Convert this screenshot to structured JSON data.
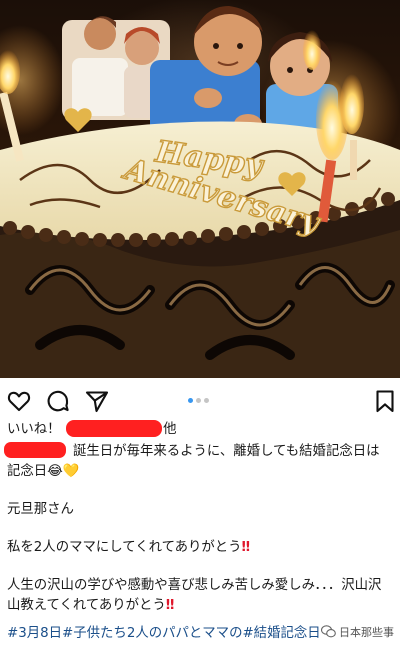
{
  "post": {
    "photo_subject": "",
    "likes_prefix": "いいね！",
    "likes_suffix": "他",
    "caption_line1": "誕生日が毎年来るように、離婚しても結婚記念日は",
    "caption_line2": "記念日",
    "caption_line2_emoji": "😂💛",
    "caption_line3": "元旦那さん",
    "caption_line4": "私を2人のママにしてくれてありがとう",
    "caption_line4_bangs": "‼",
    "caption_line5": "人生の沢山の学びや感動や喜び悲しみ苦しみ愛しみ．．．沢山沢",
    "caption_line6": "山教えてくれてありがとう",
    "caption_line6_bangs": "‼",
    "hashtags": "#3月8日#子供たち2人のパパとママの#結婚記念日"
  },
  "cake_text": {
    "line1": "Happy",
    "line2": "Anniversary"
  },
  "watermark": {
    "text": "日本那些事"
  },
  "icons": {
    "like": "heart-outline-icon",
    "comment": "comment-bubble-icon",
    "share": "paper-plane-icon",
    "save": "bookmark-icon"
  },
  "colors": {
    "accent_blue": "#3897f0",
    "hashtag": "#1b4f8a",
    "redaction": "#ff2020",
    "bangs": "#e0182c"
  }
}
